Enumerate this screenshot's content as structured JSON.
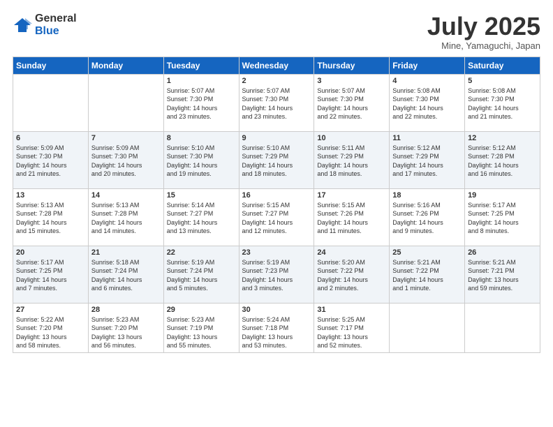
{
  "logo": {
    "general": "General",
    "blue": "Blue"
  },
  "title": "July 2025",
  "location": "Mine, Yamaguchi, Japan",
  "weekdays": [
    "Sunday",
    "Monday",
    "Tuesday",
    "Wednesday",
    "Thursday",
    "Friday",
    "Saturday"
  ],
  "weeks": [
    [
      {
        "day": "",
        "info": ""
      },
      {
        "day": "",
        "info": ""
      },
      {
        "day": "1",
        "info": "Sunrise: 5:07 AM\nSunset: 7:30 PM\nDaylight: 14 hours\nand 23 minutes."
      },
      {
        "day": "2",
        "info": "Sunrise: 5:07 AM\nSunset: 7:30 PM\nDaylight: 14 hours\nand 23 minutes."
      },
      {
        "day": "3",
        "info": "Sunrise: 5:07 AM\nSunset: 7:30 PM\nDaylight: 14 hours\nand 22 minutes."
      },
      {
        "day": "4",
        "info": "Sunrise: 5:08 AM\nSunset: 7:30 PM\nDaylight: 14 hours\nand 22 minutes."
      },
      {
        "day": "5",
        "info": "Sunrise: 5:08 AM\nSunset: 7:30 PM\nDaylight: 14 hours\nand 21 minutes."
      }
    ],
    [
      {
        "day": "6",
        "info": "Sunrise: 5:09 AM\nSunset: 7:30 PM\nDaylight: 14 hours\nand 21 minutes."
      },
      {
        "day": "7",
        "info": "Sunrise: 5:09 AM\nSunset: 7:30 PM\nDaylight: 14 hours\nand 20 minutes."
      },
      {
        "day": "8",
        "info": "Sunrise: 5:10 AM\nSunset: 7:30 PM\nDaylight: 14 hours\nand 19 minutes."
      },
      {
        "day": "9",
        "info": "Sunrise: 5:10 AM\nSunset: 7:29 PM\nDaylight: 14 hours\nand 18 minutes."
      },
      {
        "day": "10",
        "info": "Sunrise: 5:11 AM\nSunset: 7:29 PM\nDaylight: 14 hours\nand 18 minutes."
      },
      {
        "day": "11",
        "info": "Sunrise: 5:12 AM\nSunset: 7:29 PM\nDaylight: 14 hours\nand 17 minutes."
      },
      {
        "day": "12",
        "info": "Sunrise: 5:12 AM\nSunset: 7:28 PM\nDaylight: 14 hours\nand 16 minutes."
      }
    ],
    [
      {
        "day": "13",
        "info": "Sunrise: 5:13 AM\nSunset: 7:28 PM\nDaylight: 14 hours\nand 15 minutes."
      },
      {
        "day": "14",
        "info": "Sunrise: 5:13 AM\nSunset: 7:28 PM\nDaylight: 14 hours\nand 14 minutes."
      },
      {
        "day": "15",
        "info": "Sunrise: 5:14 AM\nSunset: 7:27 PM\nDaylight: 14 hours\nand 13 minutes."
      },
      {
        "day": "16",
        "info": "Sunrise: 5:15 AM\nSunset: 7:27 PM\nDaylight: 14 hours\nand 12 minutes."
      },
      {
        "day": "17",
        "info": "Sunrise: 5:15 AM\nSunset: 7:26 PM\nDaylight: 14 hours\nand 11 minutes."
      },
      {
        "day": "18",
        "info": "Sunrise: 5:16 AM\nSunset: 7:26 PM\nDaylight: 14 hours\nand 9 minutes."
      },
      {
        "day": "19",
        "info": "Sunrise: 5:17 AM\nSunset: 7:25 PM\nDaylight: 14 hours\nand 8 minutes."
      }
    ],
    [
      {
        "day": "20",
        "info": "Sunrise: 5:17 AM\nSunset: 7:25 PM\nDaylight: 14 hours\nand 7 minutes."
      },
      {
        "day": "21",
        "info": "Sunrise: 5:18 AM\nSunset: 7:24 PM\nDaylight: 14 hours\nand 6 minutes."
      },
      {
        "day": "22",
        "info": "Sunrise: 5:19 AM\nSunset: 7:24 PM\nDaylight: 14 hours\nand 5 minutes."
      },
      {
        "day": "23",
        "info": "Sunrise: 5:19 AM\nSunset: 7:23 PM\nDaylight: 14 hours\nand 3 minutes."
      },
      {
        "day": "24",
        "info": "Sunrise: 5:20 AM\nSunset: 7:22 PM\nDaylight: 14 hours\nand 2 minutes."
      },
      {
        "day": "25",
        "info": "Sunrise: 5:21 AM\nSunset: 7:22 PM\nDaylight: 14 hours\nand 1 minute."
      },
      {
        "day": "26",
        "info": "Sunrise: 5:21 AM\nSunset: 7:21 PM\nDaylight: 13 hours\nand 59 minutes."
      }
    ],
    [
      {
        "day": "27",
        "info": "Sunrise: 5:22 AM\nSunset: 7:20 PM\nDaylight: 13 hours\nand 58 minutes."
      },
      {
        "day": "28",
        "info": "Sunrise: 5:23 AM\nSunset: 7:20 PM\nDaylight: 13 hours\nand 56 minutes."
      },
      {
        "day": "29",
        "info": "Sunrise: 5:23 AM\nSunset: 7:19 PM\nDaylight: 13 hours\nand 55 minutes."
      },
      {
        "day": "30",
        "info": "Sunrise: 5:24 AM\nSunset: 7:18 PM\nDaylight: 13 hours\nand 53 minutes."
      },
      {
        "day": "31",
        "info": "Sunrise: 5:25 AM\nSunset: 7:17 PM\nDaylight: 13 hours\nand 52 minutes."
      },
      {
        "day": "",
        "info": ""
      },
      {
        "day": "",
        "info": ""
      }
    ]
  ]
}
